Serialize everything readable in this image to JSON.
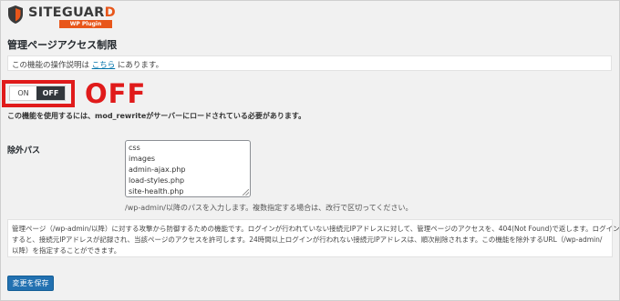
{
  "logo": {
    "brand": "SITEGUARD",
    "brand_main": "SITEGUAR",
    "brand_last": "D",
    "subtitle": "WP Plugin"
  },
  "page": {
    "title": "管理ページアクセス制限"
  },
  "notice": {
    "prefix": "この機能の操作説明は ",
    "link": "こちら",
    "suffix": " にあります。"
  },
  "toggle": {
    "on_label": "ON",
    "off_label": "OFF",
    "state": "OFF"
  },
  "annotation": {
    "off_text": "OFF",
    "color": "#e01b1b"
  },
  "requirement": "この機能を使用するには、mod_rewriteがサーバーにロードされている必要があります。",
  "exclude": {
    "label": "除外パス",
    "paths": [
      "css",
      "images",
      "admin-ajax.php",
      "load-styles.php",
      "site-health.php"
    ],
    "help": "/wp-admin/以降のパスを入力します。複数指定する場合は、改行で区切ってください。"
  },
  "description": [
    "管理ページ（/wp-admin/以降）に対する攻撃から防御するための機能です。ログインが行われていない接続元IPアドレスに対して、管理ページのアクセスを、404(Not Found)で返します。ログイン",
    "すると、接続元IPアドレスが記録され、当該ページのアクセスを許可します。24時間以上ログインが行われない接続元IPアドレスは、順次削除されます。この機能を除外するURL（/wp-admin/",
    "以降）を指定することができます。"
  ],
  "save_button": "変更を保存",
  "colors": {
    "accent": "#2271b1",
    "brand": "#e8561a",
    "toggle_active": "#32373c",
    "background": "#f1f1f1"
  }
}
